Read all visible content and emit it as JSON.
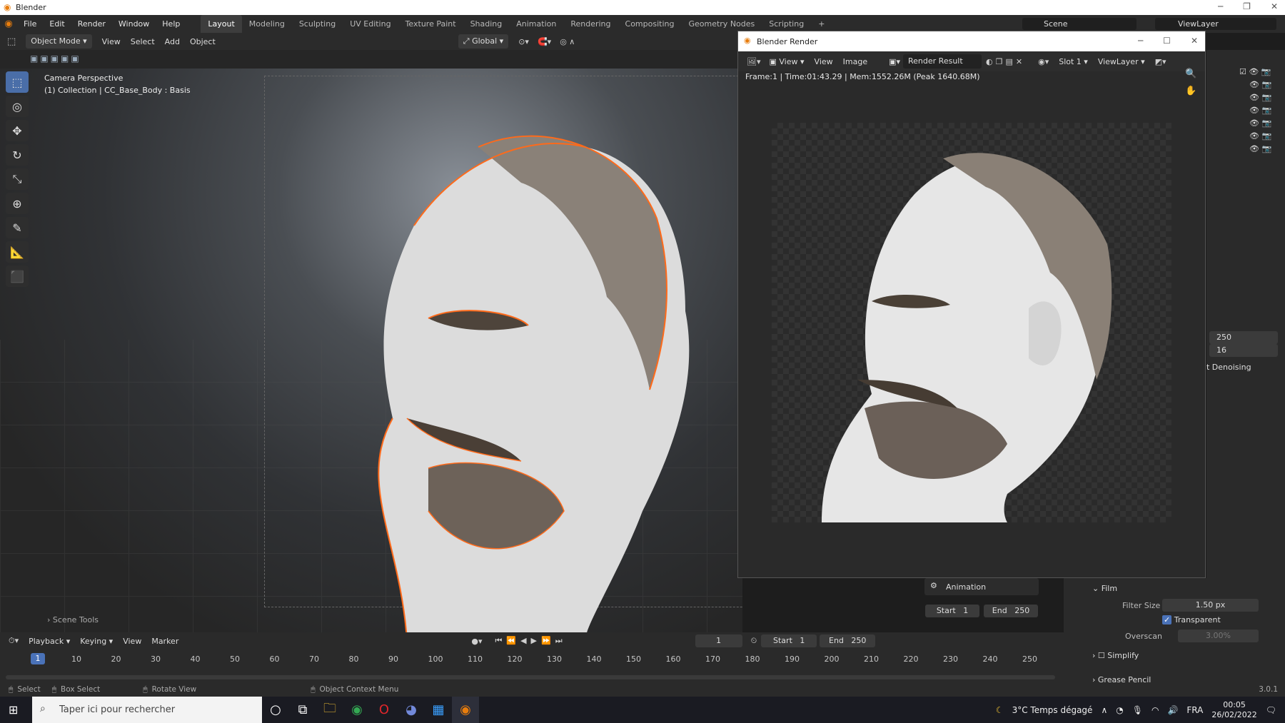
{
  "window": {
    "title": "Blender"
  },
  "menu": [
    "File",
    "Edit",
    "Render",
    "Window",
    "Help"
  ],
  "workspaces": [
    "Layout",
    "Modeling",
    "Sculpting",
    "UV Editing",
    "Texture Paint",
    "Shading",
    "Animation",
    "Rendering",
    "Compositing",
    "Geometry Nodes",
    "Scripting"
  ],
  "scene": "Scene",
  "viewlayer": "ViewLayer",
  "viewport_header": {
    "mode": "Object Mode",
    "view": "View",
    "select": "Select",
    "add": "Add",
    "object": "Object",
    "orientation": "Global"
  },
  "viewport": {
    "camera_label": "Camera Perspective",
    "collection_label": "(1) Collection | CC_Base_Body : Basis",
    "scene_tools": "Scene Tools"
  },
  "render_window": {
    "title": "Blender Render",
    "view1": "View",
    "view2": "View",
    "image": "Image",
    "result": "Render Result",
    "slot": "Slot 1",
    "viewlayer": "ViewLayer",
    "info": "Frame:1 | Time:01:43.29 | Mem:1552.26M (Peak 1640.68M)"
  },
  "properties": {
    "field1": "250",
    "field2": "16",
    "denoising": "t Denoising",
    "film": "Film",
    "filter_size_label": "Filter Size",
    "filter_size": "1.50 px",
    "transparent": "Transparent",
    "overscan_label": "Overscan",
    "overscan": "3.00%",
    "simplify": "Simplify",
    "grease_pencil": "Grease Pencil"
  },
  "animation": {
    "label": "Animation",
    "start_label": "Start",
    "start": "1",
    "end_label": "End",
    "end": "250"
  },
  "timeline": {
    "playback": "Playback",
    "keying": "Keying",
    "view": "View",
    "marker": "Marker",
    "current_frame": "1",
    "start_label": "Start",
    "start": "1",
    "end_label": "End",
    "end": "250",
    "frames": [
      "10",
      "20",
      "30",
      "40",
      "50",
      "60",
      "70",
      "80",
      "90",
      "100",
      "110",
      "120",
      "130",
      "140",
      "150",
      "160",
      "170",
      "180",
      "190",
      "200",
      "210",
      "220",
      "230",
      "240",
      "250"
    ]
  },
  "statusbar": {
    "select": "Select",
    "box_select": "Box Select",
    "rotate_view": "Rotate View",
    "context_menu": "Object Context Menu",
    "version": "3.0.1"
  },
  "taskbar": {
    "search_placeholder": "Taper ici pour rechercher",
    "weather": "3°C  Temps dégagé",
    "lang": "FRA",
    "time": "00:05",
    "date": "26/02/2022"
  }
}
